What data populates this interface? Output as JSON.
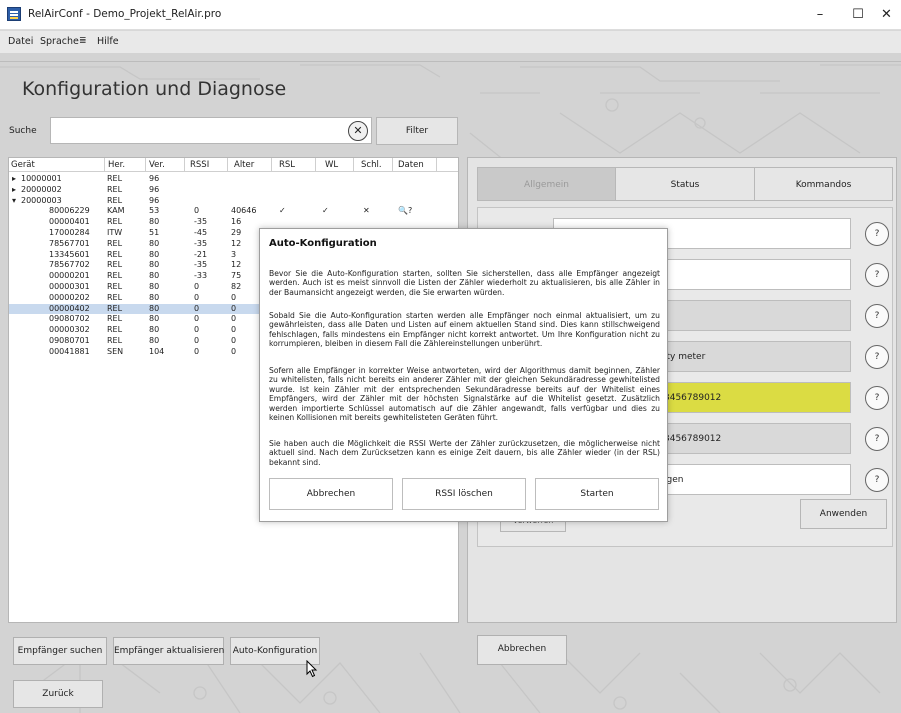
{
  "window": {
    "title": "RelAirConf - Demo_Projekt_RelAir.pro",
    "minimize": "–",
    "maximize": "☐",
    "close": "✕"
  },
  "menu": {
    "items": [
      "Datei",
      "Sprache",
      "Hilfe"
    ],
    "sprache_icon": "≣"
  },
  "page": {
    "heading": "Konfiguration und Diagnose"
  },
  "search": {
    "label": "Suche",
    "value": "",
    "clear": "✕",
    "filter_button": "Filter"
  },
  "tree": {
    "columns": [
      "Gerät",
      "Her.",
      "Ver.",
      "RSSI",
      "Alter",
      "RSL",
      "WL",
      "Schl.",
      "Daten"
    ],
    "rows": [
      {
        "toggle": "▸",
        "id": "10000001",
        "her": "REL",
        "ver": "96",
        "rssi": "",
        "alter": "",
        "rsl": "",
        "wl": "",
        "schl": "",
        "daten": ""
      },
      {
        "toggle": "▸",
        "id": "20000002",
        "her": "REL",
        "ver": "96",
        "rssi": "",
        "alter": "",
        "rsl": "",
        "wl": "",
        "schl": "",
        "daten": ""
      },
      {
        "toggle": "▾",
        "id": "20000003",
        "her": "REL",
        "ver": "96",
        "rssi": "",
        "alter": "",
        "rsl": "",
        "wl": "",
        "schl": "",
        "daten": ""
      },
      {
        "toggle": "",
        "id": "80006229",
        "her": "KAM",
        "ver": "53",
        "rssi": "0",
        "alter": "40646",
        "rsl": "✓",
        "wl": "✓",
        "schl": "✕",
        "daten": "🔍?"
      },
      {
        "toggle": "",
        "id": "00000401",
        "her": "REL",
        "ver": "80",
        "rssi": "-35",
        "alter": "16",
        "rsl": "",
        "wl": "",
        "schl": "",
        "daten": ""
      },
      {
        "toggle": "",
        "id": "17000284",
        "her": "ITW",
        "ver": "51",
        "rssi": "-45",
        "alter": "29",
        "rsl": "",
        "wl": "",
        "schl": "",
        "daten": ""
      },
      {
        "toggle": "",
        "id": "78567701",
        "her": "REL",
        "ver": "80",
        "rssi": "-35",
        "alter": "12",
        "rsl": "",
        "wl": "",
        "schl": "",
        "daten": ""
      },
      {
        "toggle": "",
        "id": "13345601",
        "her": "REL",
        "ver": "80",
        "rssi": "-21",
        "alter": "3",
        "rsl": "",
        "wl": "",
        "schl": "",
        "daten": ""
      },
      {
        "toggle": "",
        "id": "78567702",
        "her": "REL",
        "ver": "80",
        "rssi": "-35",
        "alter": "12",
        "rsl": "",
        "wl": "",
        "schl": "",
        "daten": ""
      },
      {
        "toggle": "",
        "id": "00000201",
        "her": "REL",
        "ver": "80",
        "rssi": "-33",
        "alter": "75",
        "rsl": "",
        "wl": "",
        "schl": "",
        "daten": ""
      },
      {
        "toggle": "",
        "id": "00000301",
        "her": "REL",
        "ver": "80",
        "rssi": "0",
        "alter": "82",
        "rsl": "",
        "wl": "",
        "schl": "",
        "daten": ""
      },
      {
        "toggle": "",
        "id": "00000202",
        "her": "REL",
        "ver": "80",
        "rssi": "0",
        "alter": "0",
        "rsl": "",
        "wl": "",
        "schl": "",
        "daten": ""
      },
      {
        "toggle": "",
        "id": "00000402",
        "her": "REL",
        "ver": "80",
        "rssi": "0",
        "alter": "0",
        "rsl": "",
        "wl": "",
        "schl": "",
        "daten": ""
      },
      {
        "toggle": "",
        "id": "09080702",
        "her": "REL",
        "ver": "80",
        "rssi": "0",
        "alter": "0",
        "rsl": "",
        "wl": "",
        "schl": "",
        "daten": ""
      },
      {
        "toggle": "",
        "id": "00000302",
        "her": "REL",
        "ver": "80",
        "rssi": "0",
        "alter": "0",
        "rsl": "",
        "wl": "",
        "schl": "",
        "daten": ""
      },
      {
        "toggle": "",
        "id": "09080701",
        "her": "REL",
        "ver": "80",
        "rssi": "0",
        "alter": "0",
        "rsl": "",
        "wl": "",
        "schl": "",
        "daten": ""
      },
      {
        "toggle": "",
        "id": "00041881",
        "her": "SEN",
        "ver": "104",
        "rssi": "0",
        "alter": "0",
        "rsl": "",
        "wl": "",
        "schl": "",
        "daten": ""
      }
    ],
    "selected_row": "00000402"
  },
  "right_panel": {
    "tabs": [
      "Allgemein",
      "Status",
      "Kommandos"
    ],
    "active_tab": "Allgemein",
    "fields": [
      {
        "value": "",
        "style": "white"
      },
      {
        "value": "",
        "style": "white"
      },
      {
        "value": "",
        "style": "grey"
      },
      {
        "value": "ity meter",
        "style": "grey"
      },
      {
        "value": "3456789012",
        "style": "yellow"
      },
      {
        "value": "3456789012",
        "style": "grey"
      },
      {
        "value": "igen",
        "style": "white"
      }
    ],
    "help_label": "?",
    "verwerfen_label": "Verwerfen",
    "apply_button": "Anwenden"
  },
  "bottom_buttons": {
    "find": "Empfänger suchen",
    "refresh": "Empfänger aktualisieren",
    "autoconfig": "Auto-Konfiguration",
    "cancel": "Abbrechen",
    "back": "Zurück"
  },
  "dialog": {
    "title": "Auto-Konfiguration",
    "paragraphs": [
      "Bevor Sie die Auto-Konfiguration starten, sollten Sie sicherstellen, dass alle Empfänger angezeigt werden. Auch ist es meist sinnvoll die Listen der Zähler wiederholt zu aktualisieren, bis alle Zähler in der Baumansicht angezeigt werden, die Sie erwarten würden.",
      "Sobald Sie die Auto-Konfiguration starten werden alle Empfänger noch einmal aktualisiert, um zu gewährleisten, dass alle Daten und Listen auf einem aktuellen Stand sind. Dies kann stillschweigend fehlschlagen, falls mindestens ein Empfänger nicht korrekt antwortet. Um Ihre Konfiguration nicht zu korrumpieren, bleiben in diesem Fall die Zählereinstellungen unberührt.",
      "Sofern alle Empfänger in korrekter Weise antworteten, wird der Algorithmus damit beginnen, Zähler zu whitelisten, falls nicht bereits ein anderer Zähler mit der gleichen Sekundäradresse gewhitelisted wurde. Ist kein Zähler mit der entsprechenden Sekundäradresse bereits auf der Whitelist eines Empfängers, wird der Zähler mit der höchsten Signalstärke auf die Whitelist gesetzt. Zusätzlich werden importierte Schlüssel automatisch auf die Zähler angewandt, falls verfügbar und dies zu keinen Kollisionen mit bereits gewhitelisteten Geräten führt.",
      "Sie haben auch die Möglichkeit die RSSI Werte der Zähler zurückzusetzen, die möglicherweise nicht aktuell sind. Nach dem Zurücksetzen kann es einige Zeit dauern, bis alle Zähler wieder (in der RSL) bekannt sind."
    ],
    "buttons": [
      "Abbrechen",
      "RSSI löschen",
      "Starten"
    ]
  },
  "colors": {
    "selection": "#c8d9ee",
    "highlight_field": "#dbdc43"
  }
}
